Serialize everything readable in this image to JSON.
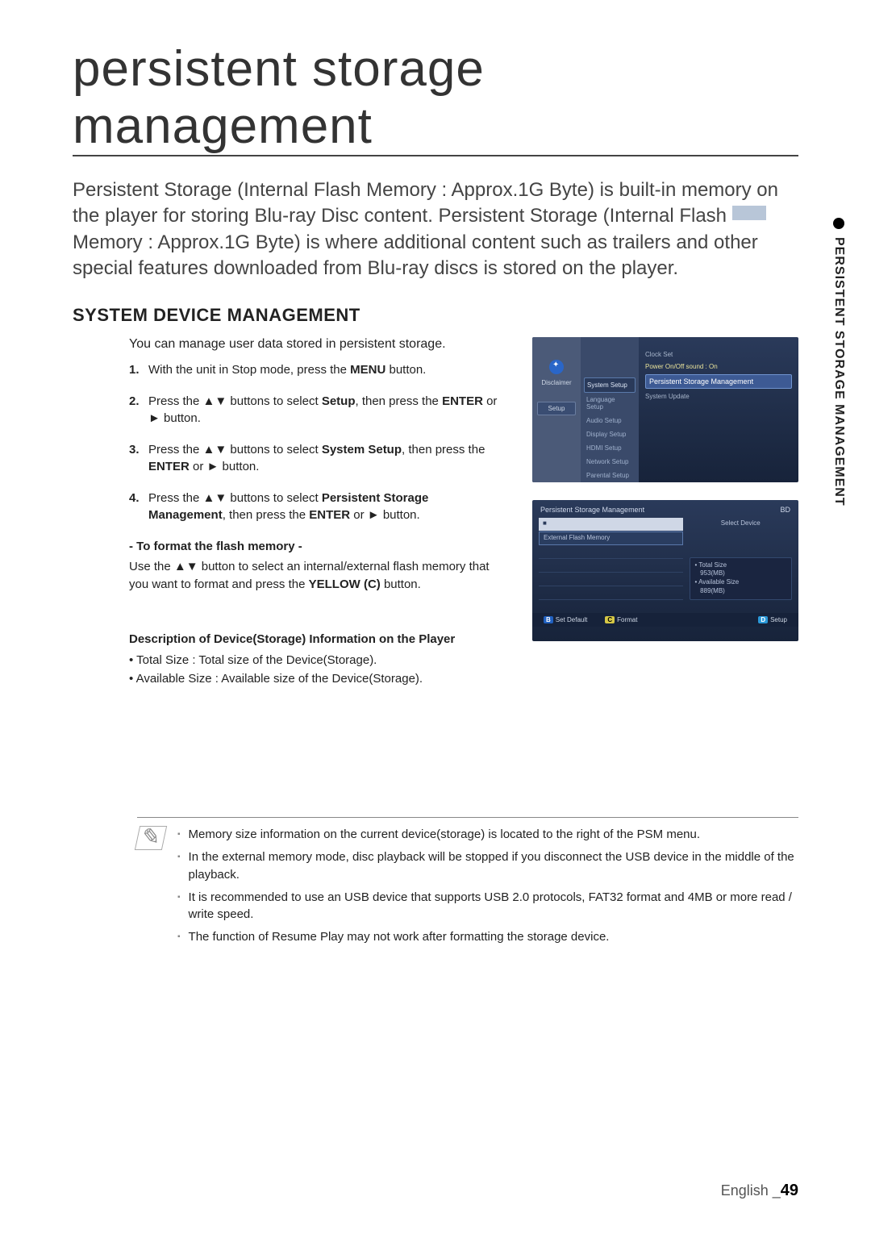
{
  "title": "persistent storage management",
  "lead": "Persistent Storage (Internal Flash Memory : Approx.1G Byte) is built-in memory on the player for storing Blu-ray Disc content. Persistent Storage (Internal Flash Memory : Approx.1G Byte) is where additional content such as trailers and other special features downloaded from Blu-ray discs is stored on the player.",
  "section_heading": "SYSTEM DEVICE MANAGEMENT",
  "side_tab": "PERSISTENT STORAGE MANAGEMENT",
  "intro": "You can manage user data stored in persistent storage.",
  "steps": {
    "s1_a": "With the unit in Stop mode, press the ",
    "s1_b": "MENU",
    "s1_c": " button.",
    "s2_a": "Press the ",
    "s2_arrows": "▲▼",
    "s2_b": " buttons to select ",
    "s2_c": "Setup",
    "s2_d": ", then press the ",
    "s2_e": "ENTER",
    "s2_f": " or ",
    "s2_g": "►",
    "s2_h": " button.",
    "s3_a": "Press the ",
    "s3_b": " buttons to select ",
    "s3_c": "System Setup",
    "s3_d": ", then press the ",
    "s3_e": "ENTER",
    "s3_f": " or ",
    "s3_g": "►",
    "s3_h": " button.",
    "s4_a": "Press the ",
    "s4_b": " buttons to select ",
    "s4_c": "Persistent Storage Management",
    "s4_d": ", then press the  ",
    "s4_e": "ENTER",
    "s4_f": " or ",
    "s4_g": "►",
    "s4_h": " button."
  },
  "format": {
    "heading": "- To format the flash memory -",
    "t1": "Use the ",
    "arrows": "▲▼",
    "t2": " button to select an internal/external flash memory that you want to format and press the ",
    "t3": "YELLOW (C)",
    "t4": " button."
  },
  "desc": {
    "heading": "Description of Device(Storage) Information on the Player",
    "line1": "Total Size : Total size of the Device(Storage).",
    "line2": "Available Size : Available size of the Device(Storage)."
  },
  "osd1": {
    "left": {
      "disclaimer": "Disclaimer",
      "setup": "Setup"
    },
    "mid": [
      "System Setup",
      "Language Setup",
      "Audio Setup",
      "Display Setup",
      "HDMI Setup",
      "Network Setup",
      "Parental Setup"
    ],
    "right": {
      "clock": "Clock Set",
      "power_label": "Power On/Off sound   :",
      "power_value": "On",
      "psm": "Persistent Storage Management",
      "update": "System Update"
    }
  },
  "osd2": {
    "title": "Persistent Storage Management",
    "badge": "BD",
    "top_row": "■",
    "ext": "External Flash Memory",
    "select_device": "Select Device",
    "total": "• Total Size\n   953(MB)",
    "avail": "• Available Size\n   889(MB)",
    "btn_b": "B",
    "btn_b_label": "Set Default",
    "btn_c": "C",
    "btn_c_label": "Format",
    "btn_d": "D",
    "btn_d_label": "Setup"
  },
  "notes": {
    "n1": "Memory size information on the current device(storage) is located to the right of the PSM menu.",
    "n2": "In the external memory mode, disc playback will be stopped if you disconnect the USB device in the middle of the playback.",
    "n3": "It is recommended to use an USB device that supports USB 2.0 protocols, FAT32 format and 4MB or more read / write speed.",
    "n4": "The function of Resume Play may not work after formatting the storage device."
  },
  "footer": {
    "lang": "English _",
    "page": "49"
  }
}
